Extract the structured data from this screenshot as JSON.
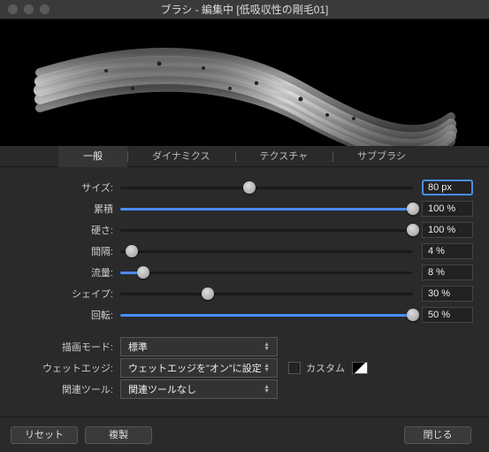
{
  "window": {
    "title": "ブラシ - 編集中 [低吸収性の剛毛01]"
  },
  "tabs": {
    "general": "一般",
    "dynamics": "ダイナミクス",
    "texture": "テクスチャ",
    "subbrush": "サブブラシ"
  },
  "sliders": {
    "size": {
      "label": "サイズ:",
      "value": "80 px",
      "pct": 44
    },
    "accum": {
      "label": "累積",
      "value": "100 %",
      "pct": 100
    },
    "hardness": {
      "label": "硬さ:",
      "value": "100 %",
      "pct": 100
    },
    "spacing": {
      "label": "間隔:",
      "value": "4 %",
      "pct": 4
    },
    "flow": {
      "label": "流量:",
      "value": "8 %",
      "pct": 8
    },
    "shape": {
      "label": "シェイプ:",
      "value": "30 %",
      "pct": 30
    },
    "rotation": {
      "label": "回転:",
      "value": "50 %",
      "pct": 100
    }
  },
  "selects": {
    "drawmode": {
      "label": "描画モード:",
      "value": "標準"
    },
    "wetedge": {
      "label": "ウェットエッジ:",
      "value": "ウェットエッジを\"オン\"に設定",
      "custom_label": "カスタム"
    },
    "tool": {
      "label": "関連ツール:",
      "value": "関連ツールなし"
    }
  },
  "buttons": {
    "reset": "リセット",
    "duplicate": "複製",
    "close": "閉じる"
  }
}
